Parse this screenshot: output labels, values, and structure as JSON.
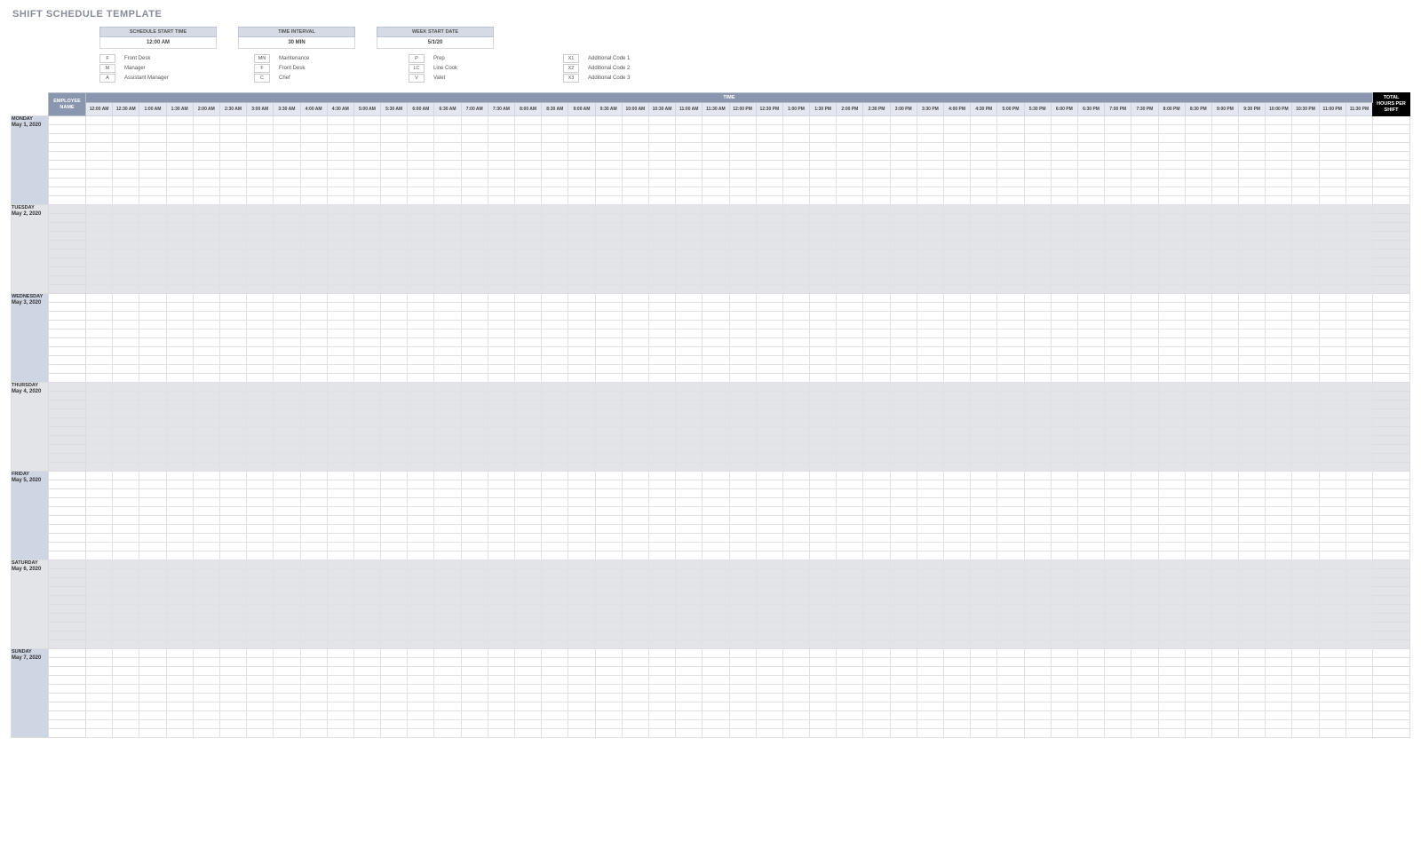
{
  "title": "SHIFT SCHEDULE TEMPLATE",
  "config": {
    "start_time_label": "SCHEDULE START TIME",
    "start_time_value": "12:00 AM",
    "interval_label": "TIME INTERVAL",
    "interval_value": "30 MIN",
    "week_start_label": "WEEK START DATE",
    "week_start_value": "5/1/20"
  },
  "legend": {
    "col1": [
      {
        "code": "F",
        "label": "Front Desk"
      },
      {
        "code": "M",
        "label": "Manager"
      },
      {
        "code": "A",
        "label": "Assistant Manager"
      }
    ],
    "col2": [
      {
        "code": "MN",
        "label": "Maintenance"
      },
      {
        "code": "F",
        "label": "Front Desk"
      },
      {
        "code": "C",
        "label": "Chef"
      }
    ],
    "col3": [
      {
        "code": "P",
        "label": "Prep"
      },
      {
        "code": "LC",
        "label": "Line Cook"
      },
      {
        "code": "V",
        "label": "Valet"
      }
    ],
    "col4": [
      {
        "code": "X1",
        "label": "Additional Code 1"
      },
      {
        "code": "X2",
        "label": "Additional Code 2"
      },
      {
        "code": "X3",
        "label": "Additional Code 3"
      }
    ]
  },
  "headers": {
    "employee": "EMPLOYEE NAME",
    "time": "TIME",
    "total": "TOTAL HOURS PER SHIFT"
  },
  "time_slots": [
    "12:00 AM",
    "12:30 AM",
    "1:00 AM",
    "1:30 AM",
    "2:00 AM",
    "2:30 AM",
    "3:00 AM",
    "3:30 AM",
    "4:00 AM",
    "4:30 AM",
    "5:00 AM",
    "5:30 AM",
    "6:00 AM",
    "6:30 AM",
    "7:00 AM",
    "7:30 AM",
    "8:00 AM",
    "8:30 AM",
    "9:00 AM",
    "9:30 AM",
    "10:00 AM",
    "10:30 AM",
    "11:00 AM",
    "11:30 AM",
    "12:00 PM",
    "12:30 PM",
    "1:00 PM",
    "1:30 PM",
    "2:00 PM",
    "2:30 PM",
    "3:00 PM",
    "3:30 PM",
    "4:00 PM",
    "4:30 PM",
    "5:00 PM",
    "5:30 PM",
    "6:00 PM",
    "6:30 PM",
    "7:00 PM",
    "7:30 PM",
    "8:00 PM",
    "8:30 PM",
    "9:00 PM",
    "9:30 PM",
    "10:00 PM",
    "10:30 PM",
    "11:00 PM",
    "11:30 PM"
  ],
  "days": [
    {
      "name": "MONDAY",
      "date": "May 1, 2020",
      "light": false,
      "rows": 10
    },
    {
      "name": "TUESDAY",
      "date": "May 2, 2020",
      "light": true,
      "rows": 10
    },
    {
      "name": "WEDNESDAY",
      "date": "May 3, 2020",
      "light": false,
      "rows": 10
    },
    {
      "name": "THURSDAY",
      "date": "May 4, 2020",
      "light": true,
      "rows": 10
    },
    {
      "name": "FRIDAY",
      "date": "May 5, 2020",
      "light": false,
      "rows": 10
    },
    {
      "name": "SATURDAY",
      "date": "May 6, 2020",
      "light": true,
      "rows": 10
    },
    {
      "name": "SUNDAY",
      "date": "May 7, 2020",
      "light": false,
      "rows": 10
    }
  ]
}
